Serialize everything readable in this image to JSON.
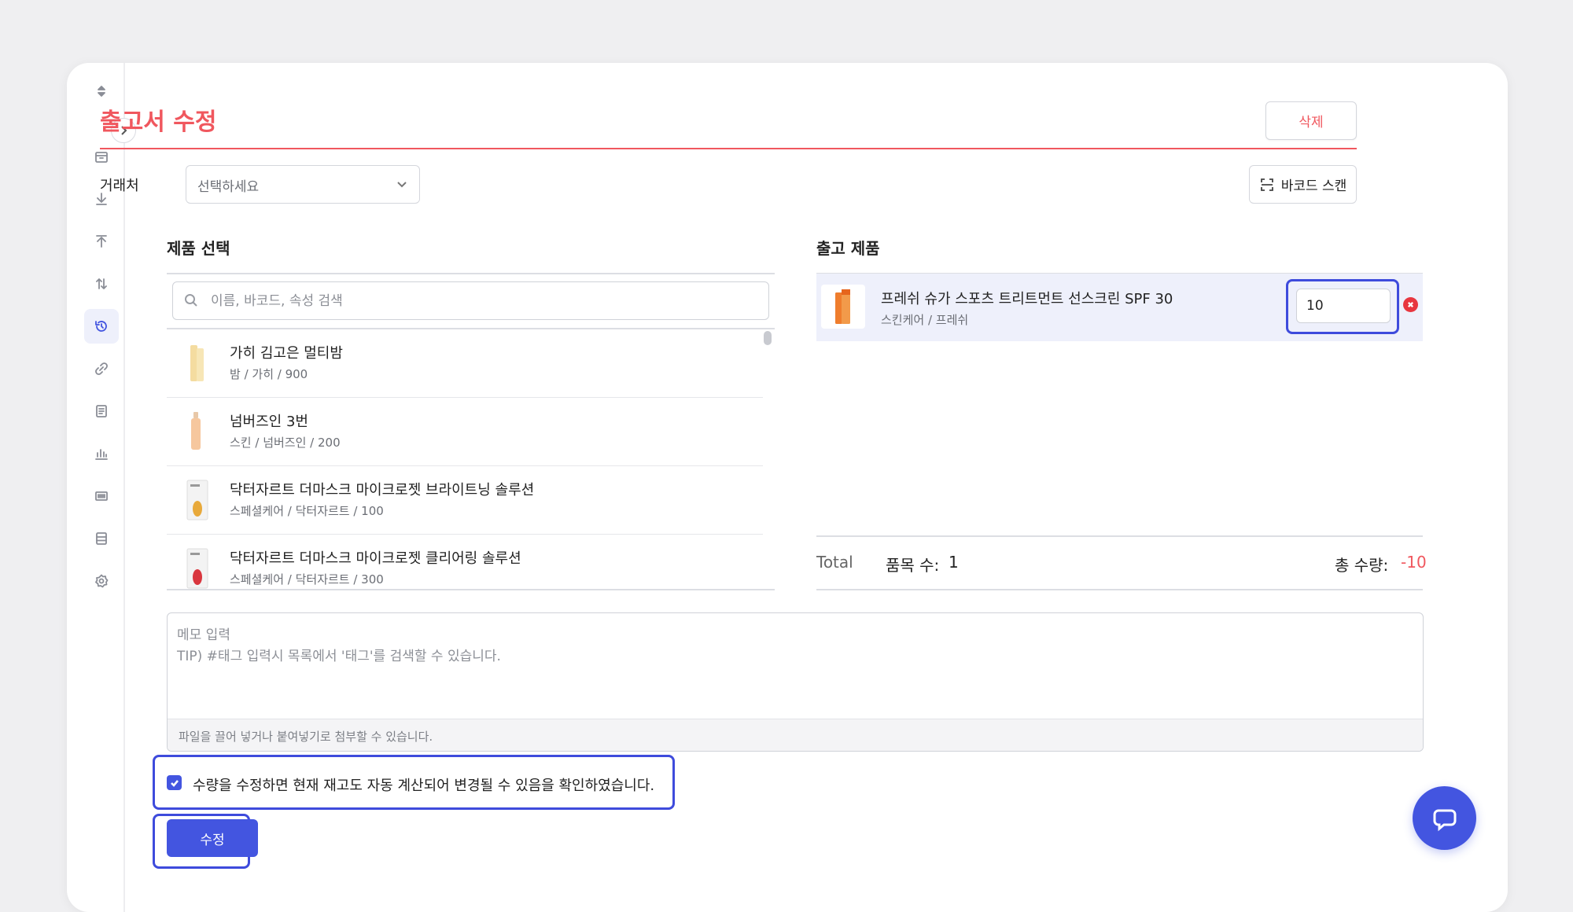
{
  "page": {
    "title": "출고서 수정",
    "delete_label": "삭제",
    "accent_color": "#f0575e",
    "primary_color": "#4355e0"
  },
  "sidebar": {
    "items": [
      {
        "icon": "sort-icon"
      },
      {
        "icon": "box-icon"
      },
      {
        "icon": "download-icon"
      },
      {
        "icon": "upload-icon"
      },
      {
        "icon": "transfer-icon"
      },
      {
        "icon": "history-icon",
        "active": true
      },
      {
        "icon": "link-icon"
      },
      {
        "icon": "document-icon"
      },
      {
        "icon": "bar-chart-icon"
      },
      {
        "icon": "barcode-icon"
      },
      {
        "icon": "database-icon"
      },
      {
        "icon": "settings-icon"
      }
    ]
  },
  "partner": {
    "label": "거래처",
    "placeholder": "선택하세요"
  },
  "barcode_scan_label": "바코드 스캔",
  "product_select": {
    "title": "제품 선택",
    "search_placeholder": "이름, 바코드, 속성 검색",
    "items": [
      {
        "name": "가히 김고은 멀티밤",
        "sub": "밤 / 가히 / 900"
      },
      {
        "name": "넘버즈인 3번",
        "sub": "스킨 / 넘버즈인 / 200"
      },
      {
        "name": "닥터자르트 더마스크 마이크로젯 브라이트닝 솔루션",
        "sub": "스페셜케어 / 닥터자르트 / 100"
      },
      {
        "name": "닥터자르트 더마스크 마이크로젯 클리어링 솔루션",
        "sub": "스페셜케어 / 닥터자르트 / 300"
      }
    ]
  },
  "outgoing": {
    "title": "출고 제품",
    "items": [
      {
        "name": "프레쉬 슈가 스포츠 트리트먼트 선스크린 SPF 30",
        "sub": "스킨케어 / 프레쉬",
        "quantity": "10"
      }
    ],
    "total_label": "Total",
    "item_count_label": "품목 수:",
    "item_count": "1",
    "total_qty_label": "총 수량:",
    "total_qty": "-10"
  },
  "memo": {
    "placeholder_line1": "메모 입력",
    "placeholder_line2": "TIP) #태그 입력시 목록에서 '태그'를 검색할 수 있습니다.",
    "attach_hint": "파일을 끌어 넣거나 붙여넣기로 첨부할 수 있습니다."
  },
  "confirm": {
    "checked": true,
    "text": "수량을 수정하면 현재 재고도 자동 계산되어 변경될 수 있음을 확인하였습니다."
  },
  "submit_label": "수정"
}
